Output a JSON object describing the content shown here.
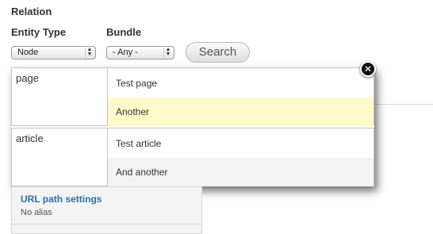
{
  "form": {
    "relation_label": "Relation",
    "entity_type": {
      "label": "Entity Type",
      "value": "Node"
    },
    "bundle": {
      "label": "Bundle",
      "value": "- Any -"
    },
    "search_label": "Search"
  },
  "popup": {
    "groups": [
      {
        "label": "page",
        "items": [
          "Test page",
          "Another"
        ]
      },
      {
        "label": "article",
        "items": [
          "Test article",
          "And another"
        ]
      }
    ],
    "close_icon": "close-icon"
  },
  "url_panel": {
    "title": "URL path settings",
    "subtitle": "No alias"
  },
  "colors": {
    "link": "#2a71a8",
    "highlight": "#fdfbca",
    "alt_row": "#f2f3f2"
  }
}
